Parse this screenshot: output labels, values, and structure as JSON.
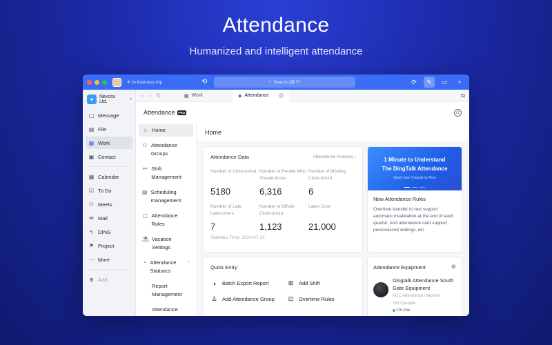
{
  "hero": {
    "title": "Attendance",
    "subtitle": "Humanized and intelligent attendance"
  },
  "titlebar": {
    "status": "In business trip",
    "search_placeholder": "Search (⌘ F)"
  },
  "org": {
    "name": "Nexora Ltd."
  },
  "leftnav": [
    {
      "label": "Message",
      "icon": "message-icon"
    },
    {
      "label": "File",
      "icon": "file-icon"
    },
    {
      "label": "Work",
      "icon": "work-grid-icon",
      "active": true
    },
    {
      "label": "Contact",
      "icon": "contact-icon"
    },
    {
      "label": "Calendar",
      "icon": "calendar-icon"
    },
    {
      "label": "To Do",
      "icon": "todo-icon"
    },
    {
      "label": "Meets",
      "icon": "meets-icon"
    },
    {
      "label": "Mail",
      "icon": "mail-icon"
    },
    {
      "label": "DING",
      "icon": "ding-icon"
    },
    {
      "label": "Project",
      "icon": "project-icon"
    },
    {
      "label": "More",
      "icon": "more-icon"
    },
    {
      "label": "Add",
      "icon": "add-icon"
    }
  ],
  "tabs": [
    {
      "label": "Work"
    },
    {
      "label": "Attendance",
      "active": true
    }
  ],
  "app": {
    "title": "Attendance",
    "badge": "PRO"
  },
  "subnav": {
    "home": "Home",
    "groups": "Attendance Groups",
    "shift": "Shift Management",
    "scheduling": "Scheduling management",
    "rules": "Attendance Rules",
    "vacation": "Vacation Settings",
    "statistics": "Attendance Statistics",
    "report": "Report Management",
    "more": "Attendance"
  },
  "main": {
    "heading": "Home",
    "attendance_data": {
      "title": "Attendance Data",
      "link": "Attendance Analysis",
      "stats": [
        {
          "label": "Number of Clock-in/out",
          "value": "5180"
        },
        {
          "label": "Number of People Who Should Arrive",
          "value": "6,316"
        },
        {
          "label": "Number of Missing Clock-in/out",
          "value": "6"
        },
        {
          "label": "Number of Late Latecomers",
          "value": "7"
        },
        {
          "label": "Number of Offsite Clock-in/out",
          "value": "1,123"
        },
        {
          "label": "Labor Cost",
          "value": "21,000"
        }
      ],
      "statistics_time": "Statistics Time: 2024-07-22"
    },
    "banner": {
      "line1": "1 Minute to Understand",
      "line2": "The DingTalk Attendance",
      "line3": "Quick Start Tutorial for Pros",
      "card_title": "New Attendance Rules",
      "card_text": "Overtime transfer to rest support automatic invalidation at the end of each quarter. And attendance card support personalized settings, etc."
    },
    "quick_entry": {
      "title": "Quick Entry",
      "items": [
        {
          "label": "Batch Export Report",
          "icon": "export-icon"
        },
        {
          "label": "Add Shift",
          "icon": "add-shift-icon"
        },
        {
          "label": "Add Attendance Group",
          "icon": "add-group-icon"
        },
        {
          "label": "Overtime Rules",
          "icon": "overtime-icon"
        }
      ]
    },
    "equipment": {
      "title": "Attendance Equipment",
      "name": "Dingtalk Attendance South Gate Equipment",
      "model": "M1C Attendance machine",
      "people": "2913 people",
      "status": "On-line"
    }
  },
  "colors": {
    "accent": "#3b6cf5",
    "background": "#1c2aa8",
    "online": "#34c759"
  }
}
